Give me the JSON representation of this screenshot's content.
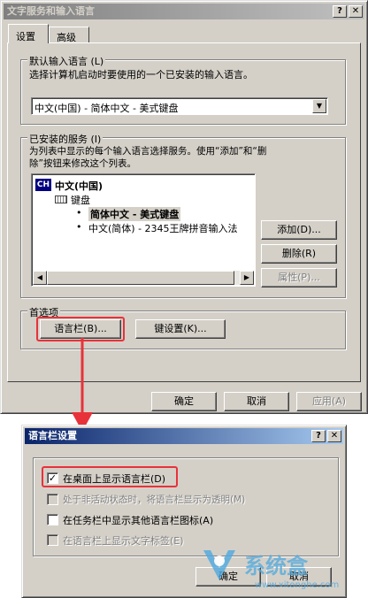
{
  "main_dialog": {
    "title": "文字服务和输入语言",
    "help_btn": "?",
    "close_btn": "✕",
    "tabs": [
      "设置",
      "高级"
    ],
    "default_lang": {
      "group_label": "默认输入语言 (L)",
      "description": "选择计算机启动时要使用的一个已安装的输入语言。",
      "selected": "中文(中国) - 简体中文 - 美式键盘"
    },
    "installed": {
      "group_label": "已安装的服务 (I)",
      "description_line1": "为列表中显示的每个输入语言选择服务。使用“添加”和“删",
      "description_line2": "除”按钮来修改这个列表。",
      "lang_code": "CH",
      "lang_name": "中文(中国)",
      "keyboard_label": "键盘",
      "services": [
        "简体中文 - 美式键盘",
        "中文(简体) - 2345王牌拼音输入法"
      ],
      "add_btn": "添加(D)...",
      "remove_btn": "删除(R)",
      "props_btn": "属性(P)..."
    },
    "prefs": {
      "group_label": "首选项",
      "langbar_btn": "语言栏(B)...",
      "keyset_btn": "键设置(K)..."
    },
    "ok": "确定",
    "cancel": "取消",
    "apply": "应用(A)"
  },
  "langbar_dialog": {
    "title": "语言栏设置",
    "help_btn": "?",
    "close_btn": "✕",
    "options": [
      {
        "label": "在桌面上显示语言栏(D)",
        "checked": true,
        "enabled": true
      },
      {
        "label": "处于非活动状态时，将语言栏显示为透明(M)",
        "checked": false,
        "enabled": false
      },
      {
        "label": "在任务栏中显示其他语言栏图标(A)",
        "checked": false,
        "enabled": true
      },
      {
        "label": "在语言栏上显示文字标签(E)",
        "checked": false,
        "enabled": false
      }
    ],
    "ok": "确定",
    "cancel": "取消"
  },
  "watermark": {
    "text": "系统盒",
    "url": "www.xitonghe.com"
  },
  "colors": {
    "highlight": "#e8323a",
    "titlebar": "#0a246a",
    "face": "#d4d0c8"
  }
}
